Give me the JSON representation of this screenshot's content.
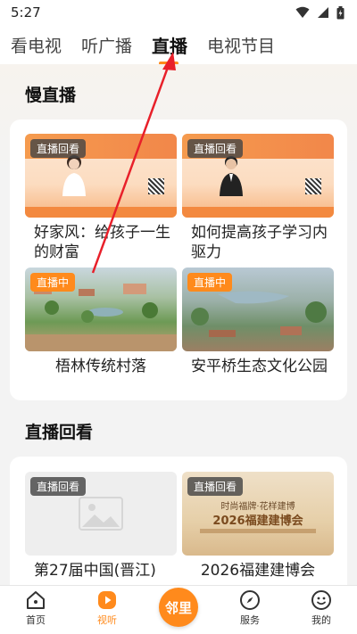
{
  "status_bar": {
    "time": "5:27"
  },
  "top_tabs": [
    {
      "label": "看电视",
      "active": false
    },
    {
      "label": "听广播",
      "active": false
    },
    {
      "label": "直播",
      "active": true
    },
    {
      "label": "电视节目",
      "active": false
    }
  ],
  "slow_live": {
    "title": "慢直播",
    "cards": [
      {
        "badge": "直播回看",
        "title": "好家风：给孩子一生的财富"
      },
      {
        "badge": "直播回看",
        "title": "如何提高孩子学习内驱力"
      },
      {
        "badge": "直播中",
        "title": "梧林传统村落"
      },
      {
        "badge": "直播中",
        "title": "安平桥生态文化公园"
      }
    ]
  },
  "replay": {
    "title": "直播回看",
    "cards": [
      {
        "badge": "直播回看",
        "title": "第27届中国(晋江)"
      },
      {
        "badge": "直播回看",
        "title": "2026福建建博会",
        "poster_line1": "时尚福牌·花样建博",
        "poster_line2": "2026福建建博会"
      }
    ]
  },
  "bottom_nav": {
    "items": [
      {
        "label": "首页",
        "icon": "home-icon",
        "active": false
      },
      {
        "label": "视听",
        "icon": "play-icon",
        "active": true
      },
      {
        "label": "服务",
        "icon": "compass-icon",
        "active": false
      },
      {
        "label": "我的",
        "icon": "profile-icon",
        "active": false
      }
    ],
    "center_label": "邻里"
  },
  "colors": {
    "accent": "#ff8a1c",
    "annotation": "#e8202a"
  }
}
